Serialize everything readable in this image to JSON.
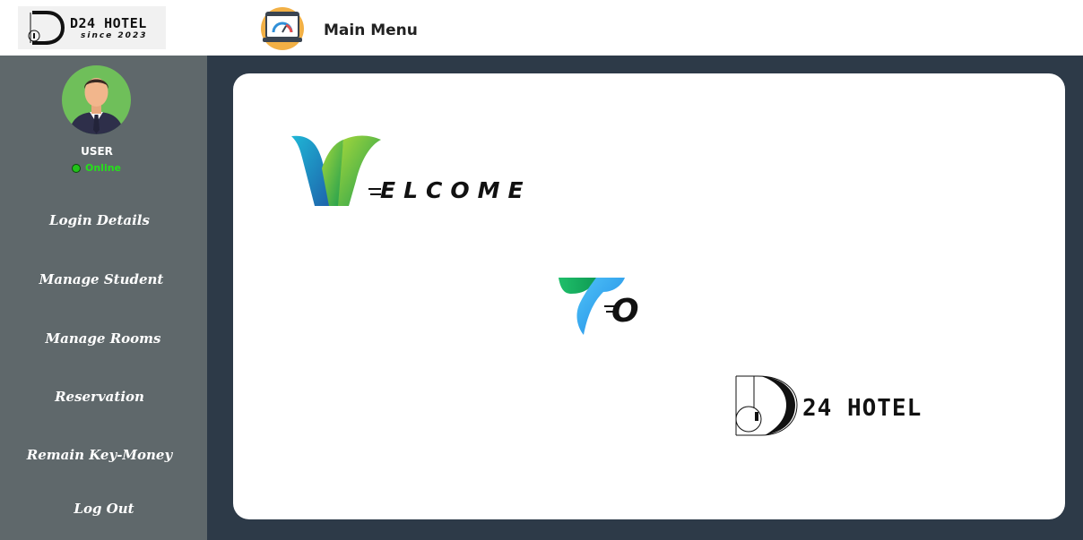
{
  "header": {
    "brand_name": "D24 HOTEL",
    "brand_since": "since 2023",
    "page_title": "Main Menu",
    "icon": "dashboard-laptop-icon"
  },
  "user": {
    "label": "USER",
    "status": "Online",
    "status_color": "#26e01b",
    "avatar": "businessman-avatar"
  },
  "sidebar": {
    "items": [
      {
        "label": "Login Details"
      },
      {
        "label": "Manage Student"
      },
      {
        "label": "Manage Rooms"
      },
      {
        "label": "Reservation"
      },
      {
        "label": "Remain Key-Money"
      },
      {
        "label": "Log Out"
      }
    ]
  },
  "main": {
    "welcome_text": "ELCOME",
    "to_text": "O",
    "hotel_text": "24 HOTEL"
  },
  "colors": {
    "sidebar_bg": "#5f686b",
    "page_bg": "#2d3a48",
    "panel_bg": "#ffffff"
  }
}
